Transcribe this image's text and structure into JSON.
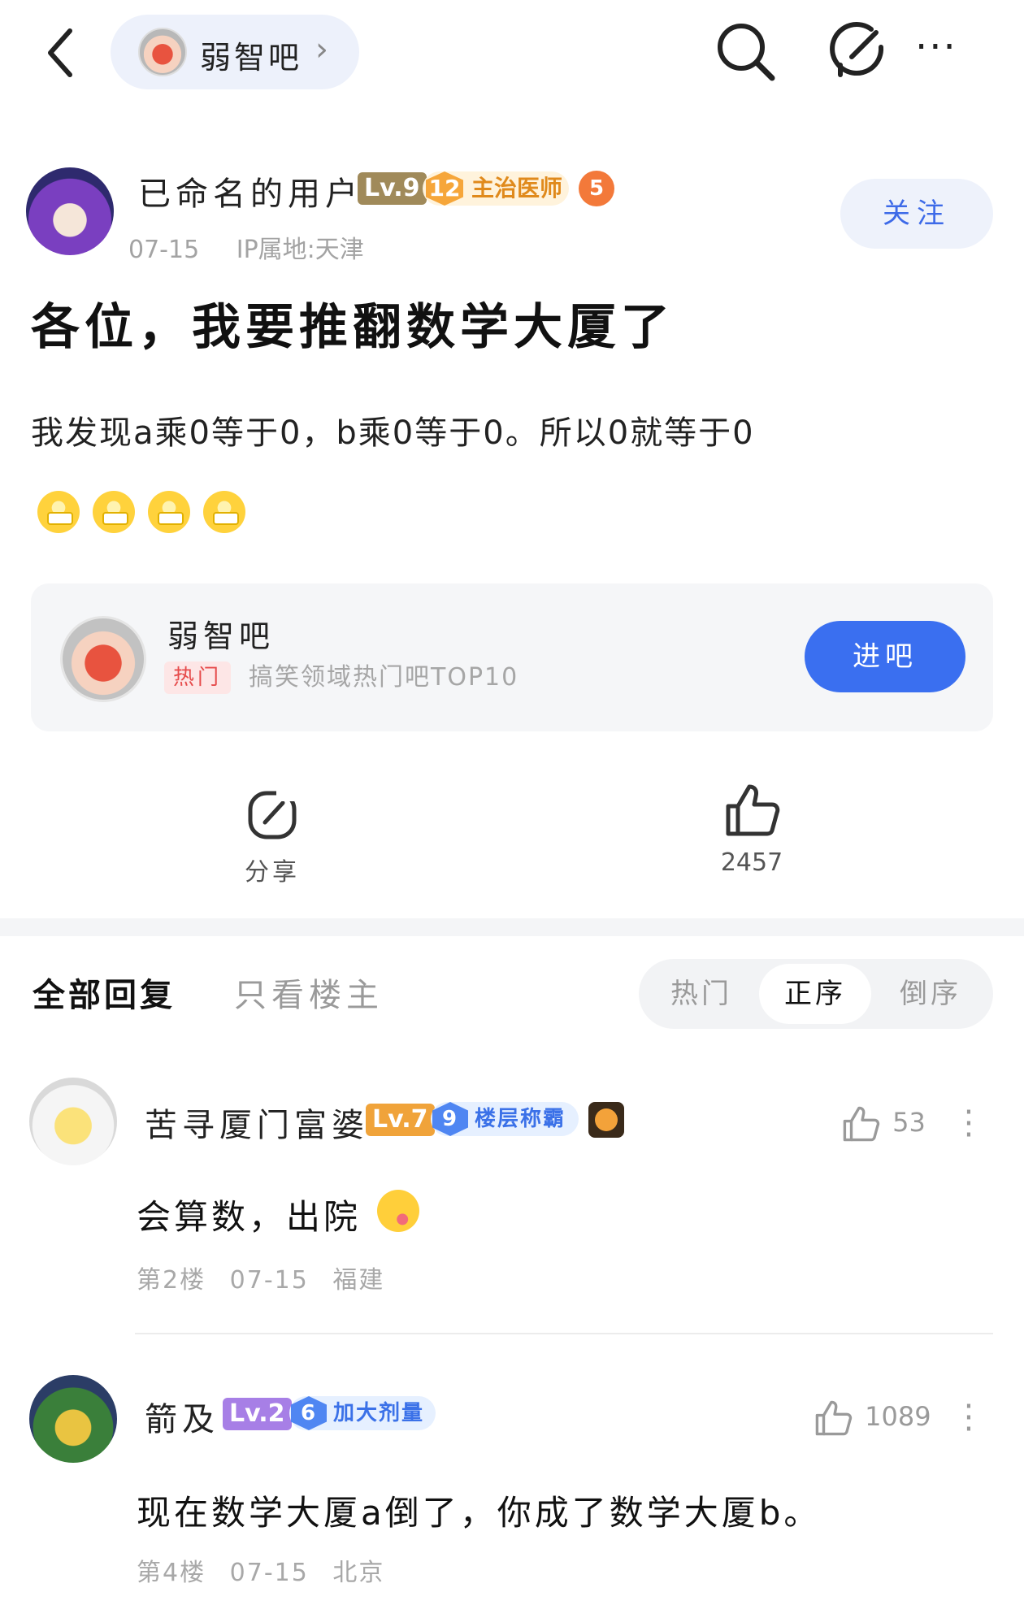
{
  "topbar": {
    "back_icon": "chevron-left-icon",
    "forum_name": "弱智吧",
    "chevron": "›",
    "search_icon": "search-icon",
    "edit_icon": "edit-icon",
    "more_icon": "···"
  },
  "author": {
    "name": "已命名的用户",
    "level": "Lv.9",
    "rank_num": "12",
    "rank_title": "主治医师",
    "medal": "5",
    "date": "07-15",
    "ip": "IP属地:天津",
    "follow_label": "关注"
  },
  "post": {
    "title": "各位，我要推翻数学大厦了",
    "body": "我发现a乘0等于0，b乘0等于0。所以0就等于0",
    "emoji_count": 4
  },
  "forum_card": {
    "name": "弱智吧",
    "hot_tag": "热门",
    "description": "搞笑领域热门吧TOP10",
    "enter_label": "进吧"
  },
  "actions": {
    "share_label": "分享",
    "like_count": "2457"
  },
  "filters": {
    "all_replies": "全部回复",
    "op_only": "只看楼主",
    "sort_hot": "热门",
    "sort_asc": "正序",
    "sort_desc": "倒序",
    "active_sort": "正序"
  },
  "comments": [
    {
      "name": "苦寻厦门富婆",
      "level": "Lv.7",
      "level_color": "#f0a33a",
      "tag_num": "9",
      "tag_title": "楼层称霸",
      "likes": "53",
      "text": "会算数，出院",
      "floor": "第2楼",
      "date": "07-15",
      "location": "福建"
    },
    {
      "name": "箭及",
      "level": "Lv.2",
      "level_color": "#a77fe6",
      "tag_num": "6",
      "tag_title": "加大剂量",
      "likes": "1089",
      "text": "现在数学大厦a倒了，你成了数学大厦b。",
      "floor": "第4楼",
      "date": "07-15",
      "location": "北京"
    }
  ],
  "colors": {
    "accent": "#3a6ff0",
    "pill_bg": "#edf1fb",
    "hot_red": "#e64b4b"
  }
}
